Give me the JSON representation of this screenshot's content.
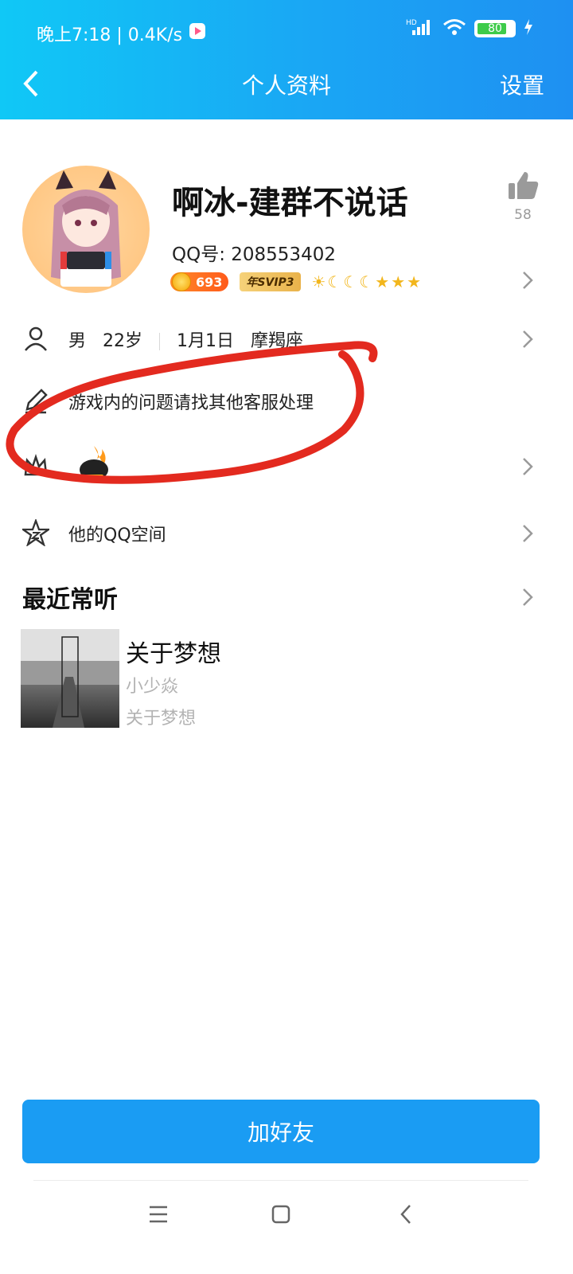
{
  "status_bar": {
    "time": "晚上7:18 | 0.4K/s",
    "network_label": "HD",
    "battery": "80"
  },
  "app_bar": {
    "title": "个人资料",
    "settings": "设置"
  },
  "profile": {
    "nickname": "啊冰-建群不说话",
    "qq_label": "QQ号: 208553402",
    "likes": "58",
    "level_badge": "693",
    "vip_badge": "年SVIP3",
    "level_icons": [
      "sun",
      "moon",
      "moon",
      "moon",
      "star",
      "star",
      "star"
    ]
  },
  "info_rows": {
    "basic": {
      "gender": "男",
      "age": "22岁",
      "birthday": "1月1日",
      "zodiac": "摩羯座"
    },
    "signature": "游戏内的问题请找其他客服处理"
  },
  "qzone": {
    "label": "他的QQ空间"
  },
  "recent": {
    "title": "最近常听",
    "song": {
      "title": "关于梦想",
      "artist": "小少焱",
      "album": "关于梦想"
    }
  },
  "actions": {
    "add_friend": "加好友"
  },
  "colors": {
    "header_start": "#10c8f6",
    "header_end": "#1e90f2",
    "button_blue": "#1a9cf3",
    "annotation_red": "#e32a1f"
  }
}
